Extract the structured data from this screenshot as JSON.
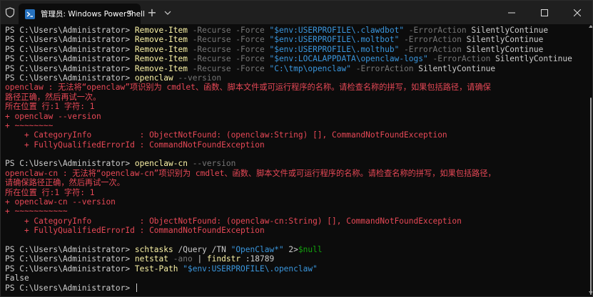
{
  "window": {
    "tab_title": "管理员: Windows PowerShell",
    "tab_close": "✕",
    "new_tab": "+",
    "icons": {
      "shield": "shield-icon",
      "powershell": "powershell-icon",
      "dropdown": "chevron-down-icon",
      "minimize": "minimize-icon",
      "maximize": "maximize-icon",
      "close": "close-icon"
    }
  },
  "colors": {
    "background": "#0c0c0c",
    "titlebar": "#1f1f1f",
    "text": "#cccccc",
    "command": "#f9f1a5",
    "parameter": "#767676",
    "string": "#3a96dd",
    "variable": "#13a10e",
    "error": "#e74856"
  },
  "terminal": {
    "lines": [
      [
        {
          "t": "PS C:\\Users\\Administrator> ",
          "c": "plain"
        },
        {
          "t": "Remove-Item",
          "c": "cmd"
        },
        {
          "t": " -Recurse -Force ",
          "c": "param"
        },
        {
          "t": "\"$env:USERPROFILE\\.clawdbot\"",
          "c": "str"
        },
        {
          "t": " -ErrorAction",
          "c": "param"
        },
        {
          "t": " SilentlyContinue",
          "c": "plain"
        }
      ],
      [
        {
          "t": "PS C:\\Users\\Administrator> ",
          "c": "plain"
        },
        {
          "t": "Remove-Item",
          "c": "cmd"
        },
        {
          "t": " -Recurse -Force ",
          "c": "param"
        },
        {
          "t": "\"$env:USERPROFILE\\.moltbot\"",
          "c": "str"
        },
        {
          "t": " -ErrorAction",
          "c": "param"
        },
        {
          "t": " SilentlyContinue",
          "c": "plain"
        }
      ],
      [
        {
          "t": "PS C:\\Users\\Administrator> ",
          "c": "plain"
        },
        {
          "t": "Remove-Item",
          "c": "cmd"
        },
        {
          "t": " -Recurse -Force ",
          "c": "param"
        },
        {
          "t": "\"$env:USERPROFILE\\.molthub\"",
          "c": "str"
        },
        {
          "t": " -ErrorAction",
          "c": "param"
        },
        {
          "t": " SilentlyContinue",
          "c": "plain"
        }
      ],
      [
        {
          "t": "PS C:\\Users\\Administrator> ",
          "c": "plain"
        },
        {
          "t": "Remove-Item",
          "c": "cmd"
        },
        {
          "t": " -Recurse -Force ",
          "c": "param"
        },
        {
          "t": "\"$env:LOCALAPPDATA\\openclaw-logs\"",
          "c": "str"
        },
        {
          "t": " -ErrorAction",
          "c": "param"
        },
        {
          "t": " SilentlyContinue",
          "c": "plain"
        }
      ],
      [
        {
          "t": "PS C:\\Users\\Administrator> ",
          "c": "plain"
        },
        {
          "t": "Remove-Item",
          "c": "cmd"
        },
        {
          "t": " -Recurse -Force ",
          "c": "param"
        },
        {
          "t": "\"C:\\tmp\\openclaw\"",
          "c": "str"
        },
        {
          "t": " -ErrorAction",
          "c": "param"
        },
        {
          "t": " SilentlyContinue",
          "c": "plain"
        }
      ],
      [
        {
          "t": "PS C:\\Users\\Administrator> ",
          "c": "plain"
        },
        {
          "t": "openclaw",
          "c": "cmd"
        },
        {
          "t": " --version",
          "c": "param"
        }
      ],
      [
        {
          "t": "openclaw : 无法将“openclaw”项识别为 cmdlet、函数、脚本文件或可运行程序的名称。请检查名称的拼写，如果包括路径，请确保",
          "c": "err"
        }
      ],
      [
        {
          "t": "路径正确，然后再试一次。",
          "c": "err"
        }
      ],
      [
        {
          "t": "所在位置 行:1 字符: 1",
          "c": "err"
        }
      ],
      [
        {
          "t": "+ openclaw --version",
          "c": "err"
        }
      ],
      [
        {
          "t": "+ ~~~~~~~~",
          "c": "err"
        }
      ],
      [
        {
          "t": "    + CategoryInfo          : ObjectNotFound: (openclaw:String) [], CommandNotFoundException",
          "c": "err"
        }
      ],
      [
        {
          "t": "    + FullyQualifiedErrorId : CommandNotFoundException",
          "c": "err"
        }
      ],
      [
        {
          "t": "",
          "c": "plain"
        }
      ],
      [
        {
          "t": "PS C:\\Users\\Administrator> ",
          "c": "plain"
        },
        {
          "t": "openclaw-cn",
          "c": "cmd"
        },
        {
          "t": " --version",
          "c": "param"
        }
      ],
      [
        {
          "t": "openclaw-cn : 无法将“openclaw-cn”项识别为 cmdlet、函数、脚本文件或可运行程序的名称。请检查名称的拼写，如果包括路径，",
          "c": "err"
        }
      ],
      [
        {
          "t": "请确保路径正确，然后再试一次。",
          "c": "err"
        }
      ],
      [
        {
          "t": "所在位置 行:1 字符: 1",
          "c": "err"
        }
      ],
      [
        {
          "t": "+ openclaw-cn --version",
          "c": "err"
        }
      ],
      [
        {
          "t": "+ ~~~~~~~~~~~",
          "c": "err"
        }
      ],
      [
        {
          "t": "    + CategoryInfo          : ObjectNotFound: (openclaw-cn:String) [], CommandNotFoundException",
          "c": "err"
        }
      ],
      [
        {
          "t": "    + FullyQualifiedErrorId : CommandNotFoundException",
          "c": "err"
        }
      ],
      [
        {
          "t": "",
          "c": "plain"
        }
      ],
      [
        {
          "t": "PS C:\\Users\\Administrator> ",
          "c": "plain"
        },
        {
          "t": "schtasks",
          "c": "cmd"
        },
        {
          "t": " /Query /TN ",
          "c": "plain"
        },
        {
          "t": "\"OpenClaw*\"",
          "c": "str"
        },
        {
          "t": " 2>",
          "c": "plain"
        },
        {
          "t": "$null",
          "c": "var"
        }
      ],
      [
        {
          "t": "PS C:\\Users\\Administrator> ",
          "c": "plain"
        },
        {
          "t": "netstat",
          "c": "cmd"
        },
        {
          "t": " -ano",
          "c": "param"
        },
        {
          "t": " | ",
          "c": "plain"
        },
        {
          "t": "findstr",
          "c": "cmd"
        },
        {
          "t": " :18789",
          "c": "plain"
        }
      ],
      [
        {
          "t": "PS C:\\Users\\Administrator> ",
          "c": "plain"
        },
        {
          "t": "Test-Path",
          "c": "cmd"
        },
        {
          "t": " ",
          "c": "plain"
        },
        {
          "t": "\"$env:USERPROFILE\\.openclaw\"",
          "c": "str"
        }
      ],
      [
        {
          "t": "False",
          "c": "plain"
        }
      ],
      [
        {
          "t": "PS C:\\Users\\Administrator> ",
          "c": "plain"
        }
      ]
    ]
  }
}
